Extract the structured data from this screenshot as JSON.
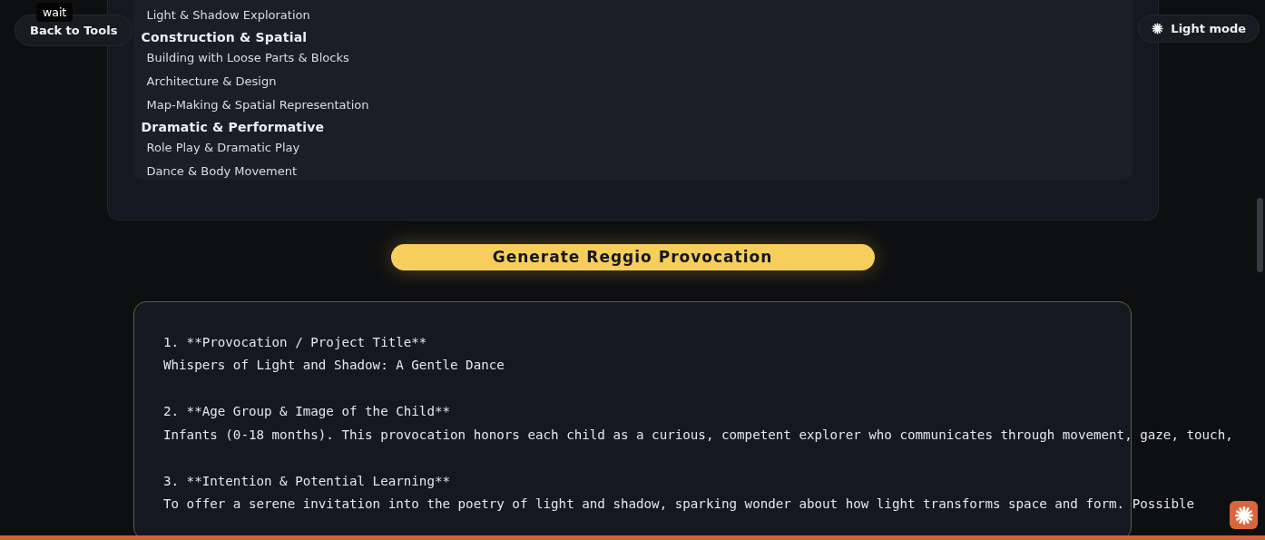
{
  "back_button": {
    "label": "Back to Tools"
  },
  "tooltip": {
    "text": "wait"
  },
  "theme_toggle": {
    "label": "Light mode"
  },
  "groups": [
    {
      "items": [
        "Light & Shadow Exploration"
      ]
    },
    {
      "heading": "Construction & Spatial",
      "items": [
        "Building with Loose Parts & Blocks",
        "Architecture & Design",
        "Map-Making & Spatial Representation"
      ]
    },
    {
      "heading": "Dramatic & Performative",
      "items": [
        "Role Play & Dramatic Play",
        "Dance & Body Movement"
      ]
    }
  ],
  "generate_button": {
    "label": "Generate Reggio Provocation"
  },
  "output": [
    {
      "title": "1. **Provocation / Project Title**",
      "body": "Whispers of Light and Shadow: A Gentle Dance"
    },
    {
      "title": "2. **Age Group & Image of the Child**",
      "body": "Infants (0-18 months). This provocation honors each child as a curious, competent explorer who communicates through movement, gaze, touch,"
    },
    {
      "title": "3. **Intention & Potential Learning**",
      "body": "To offer a serene invitation into the poetry of light and shadow, sparking wonder about how light transforms space and form. Possible"
    }
  ]
}
